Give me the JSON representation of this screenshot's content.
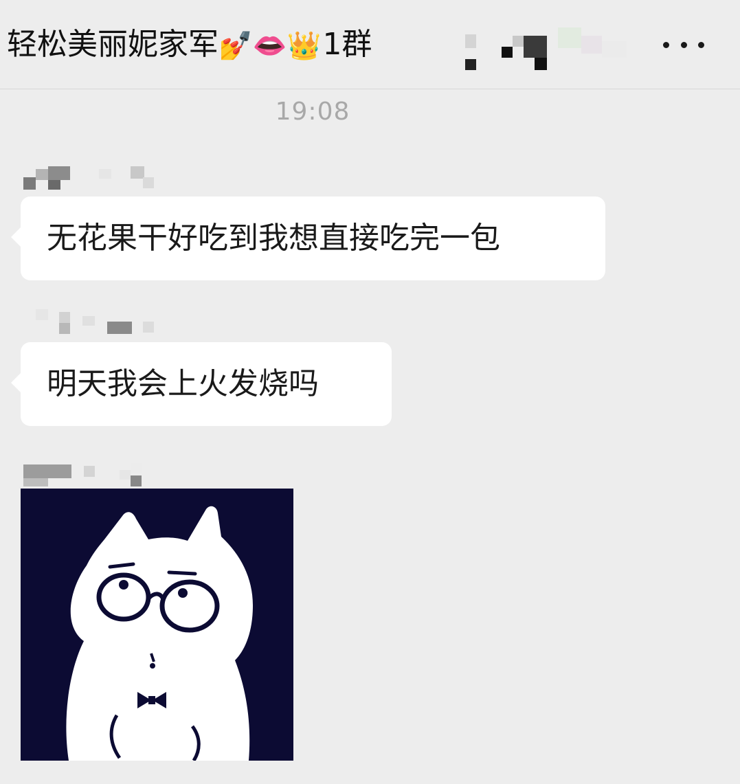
{
  "header": {
    "title": "轻松美丽妮家军",
    "title_emojis": [
      "💅",
      "👄",
      "👑"
    ],
    "title_suffix": "1群",
    "more_icon": "more-dots-icon"
  },
  "timestamp": "19:08",
  "messages": [
    {
      "text": "无花果干好吃到我想直接吃完一包"
    },
    {
      "text": "明天我会上火发烧吗"
    }
  ],
  "sticker": {
    "icon": "cartoon-cat-sticker",
    "background": "#0c0b33"
  },
  "colors": {
    "background": "#ededed",
    "bubble": "#ffffff",
    "text": "#1a1a1a",
    "timestamp": "#a8a8a8"
  }
}
